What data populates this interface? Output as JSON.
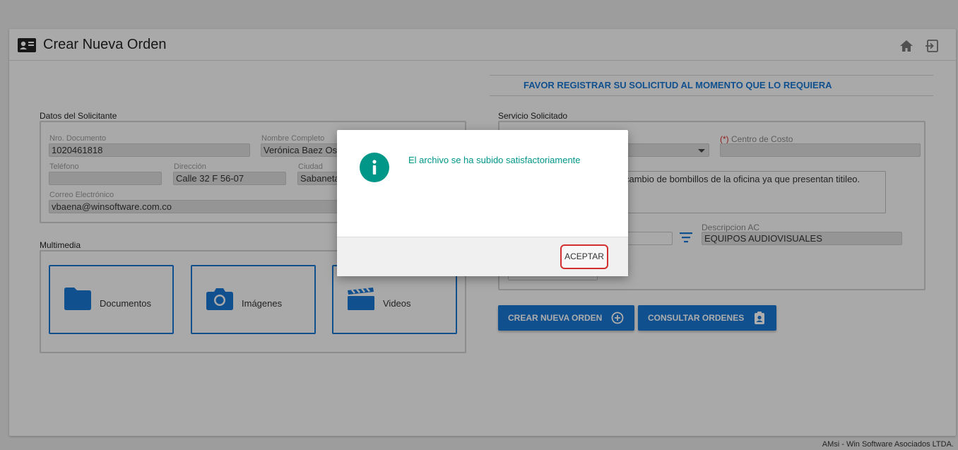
{
  "header": {
    "title": "Crear Nueva Orden",
    "home_icon": "home-icon",
    "exit_icon": "exit-icon"
  },
  "notice": "FAVOR REGISTRAR SU SOLICITUD AL MOMENTO QUE LO REQUIERA",
  "solicitante": {
    "section_label": "Datos del Solicitante",
    "nro_documento": {
      "label": "Nro. Documento",
      "value": "1020461818"
    },
    "nombre": {
      "label": "Nombre Completo",
      "value": "Verónica Baez Oso"
    },
    "telefono": {
      "label": "Teléfono",
      "value": ""
    },
    "direccion": {
      "label": "Dirección",
      "value": "Calle 32 F 56-07"
    },
    "ciudad": {
      "label": "Ciudad",
      "value": "Sabaneta"
    },
    "correo": {
      "label": "Correo Electrónico",
      "value": "vbaena@winsoftware.com.co"
    }
  },
  "multimedia": {
    "section_label": "Multimedia",
    "documentos": "Documentos",
    "imagenes": "Imágenes",
    "videos": "Videos"
  },
  "servicio": {
    "section_label": "Servicio Solicitado",
    "centro_costo_req": "(*)",
    "centro_costo_label": " Centro de Costo",
    "centro_costo_value": "",
    "descripcion_text": "cambio de bombillos de la oficina ya que presentan titileo.",
    "descripcion_ac_label": "Descripcion AC",
    "descripcion_ac_value": "EQUIPOS AUDIOVISUALES"
  },
  "buttons": {
    "crear": "CREAR NUEVA ORDEN",
    "consultar": "CONSULTAR ORDENES"
  },
  "footer": "AMsi - Win Software Asociados LTDA.",
  "modal": {
    "message": "El archivo se ha subido satisfactoriamente",
    "accept": "ACEPTAR"
  },
  "colors": {
    "primary": "#1976d2",
    "teal": "#009688",
    "danger": "#d32f2f"
  }
}
